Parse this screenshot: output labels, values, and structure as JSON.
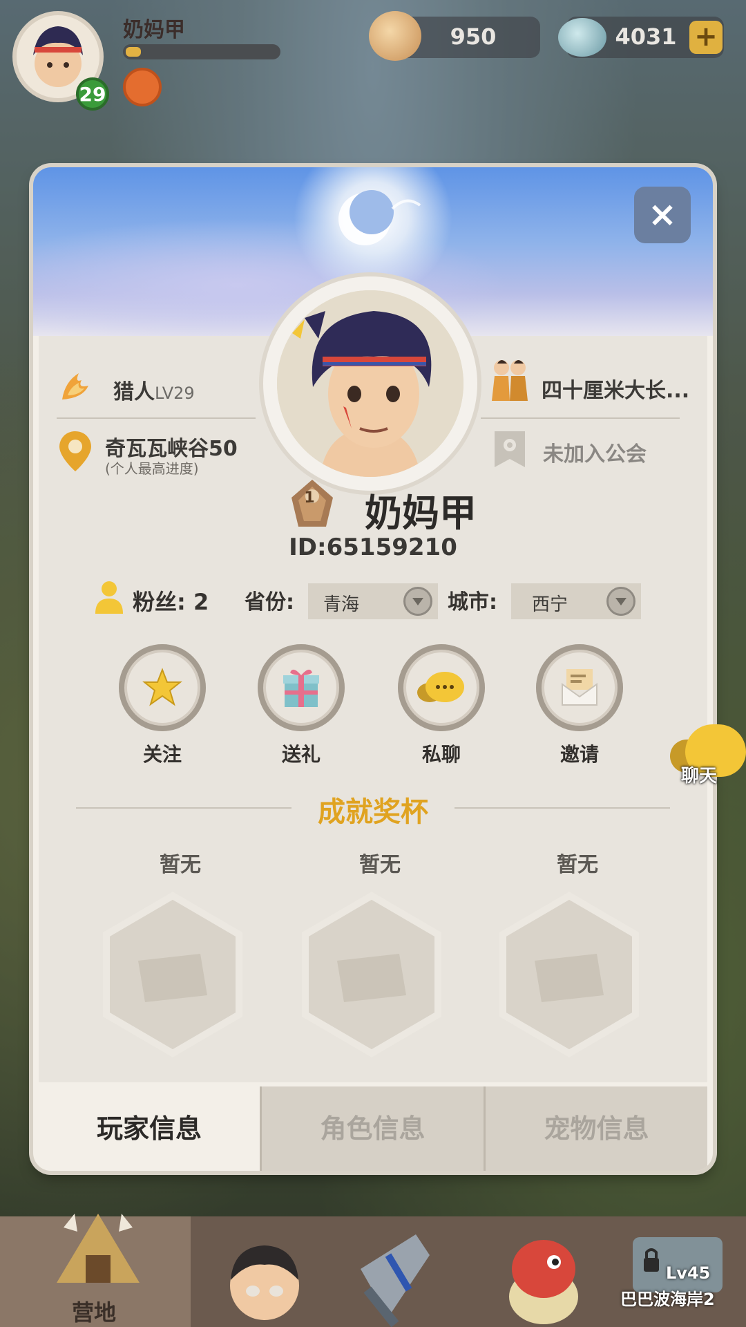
{
  "hud": {
    "player_name": "奶妈甲",
    "level": "29",
    "currency1": "950",
    "currency2": "4031",
    "add_label": "+"
  },
  "profile": {
    "class_label": "猎人",
    "class_level": "LV29",
    "location": "奇瓦瓦峡谷50",
    "location_hint": "(个人最高进度)",
    "partner": "四十厘米大长...",
    "guild": "未加入公会",
    "name": "奶妈甲",
    "rank_number": "1",
    "id_text": "ID:65159210",
    "fans_label": "粉丝:",
    "fans_count": "2",
    "province_label": "省份:",
    "province_value": "青海",
    "city_label": "城市:",
    "city_value": "西宁",
    "close_label": "×"
  },
  "actions": [
    {
      "label": "关注",
      "icon": "star-icon"
    },
    {
      "label": "送礼",
      "icon": "gift-icon"
    },
    {
      "label": "私聊",
      "icon": "chat-icon"
    },
    {
      "label": "邀请",
      "icon": "mail-icon"
    }
  ],
  "trophies": {
    "title": "成就奖杯",
    "slots": [
      {
        "label": "暂无"
      },
      {
        "label": "暂无"
      },
      {
        "label": "暂无"
      }
    ]
  },
  "tabs": [
    {
      "label": "玩家信息",
      "active": true
    },
    {
      "label": "角色信息",
      "active": false
    },
    {
      "label": "宠物信息",
      "active": false
    }
  ],
  "side": {
    "chat_label": "聊天"
  },
  "bottom_nav": {
    "camp_label": "营地",
    "locked_level": "Lv45",
    "locked_area": "巴巴波海岸2"
  },
  "colors": {
    "accent_gold": "#e0a320",
    "level_green": "#3a9b3a",
    "panel_bg": "#e8e4dd"
  }
}
